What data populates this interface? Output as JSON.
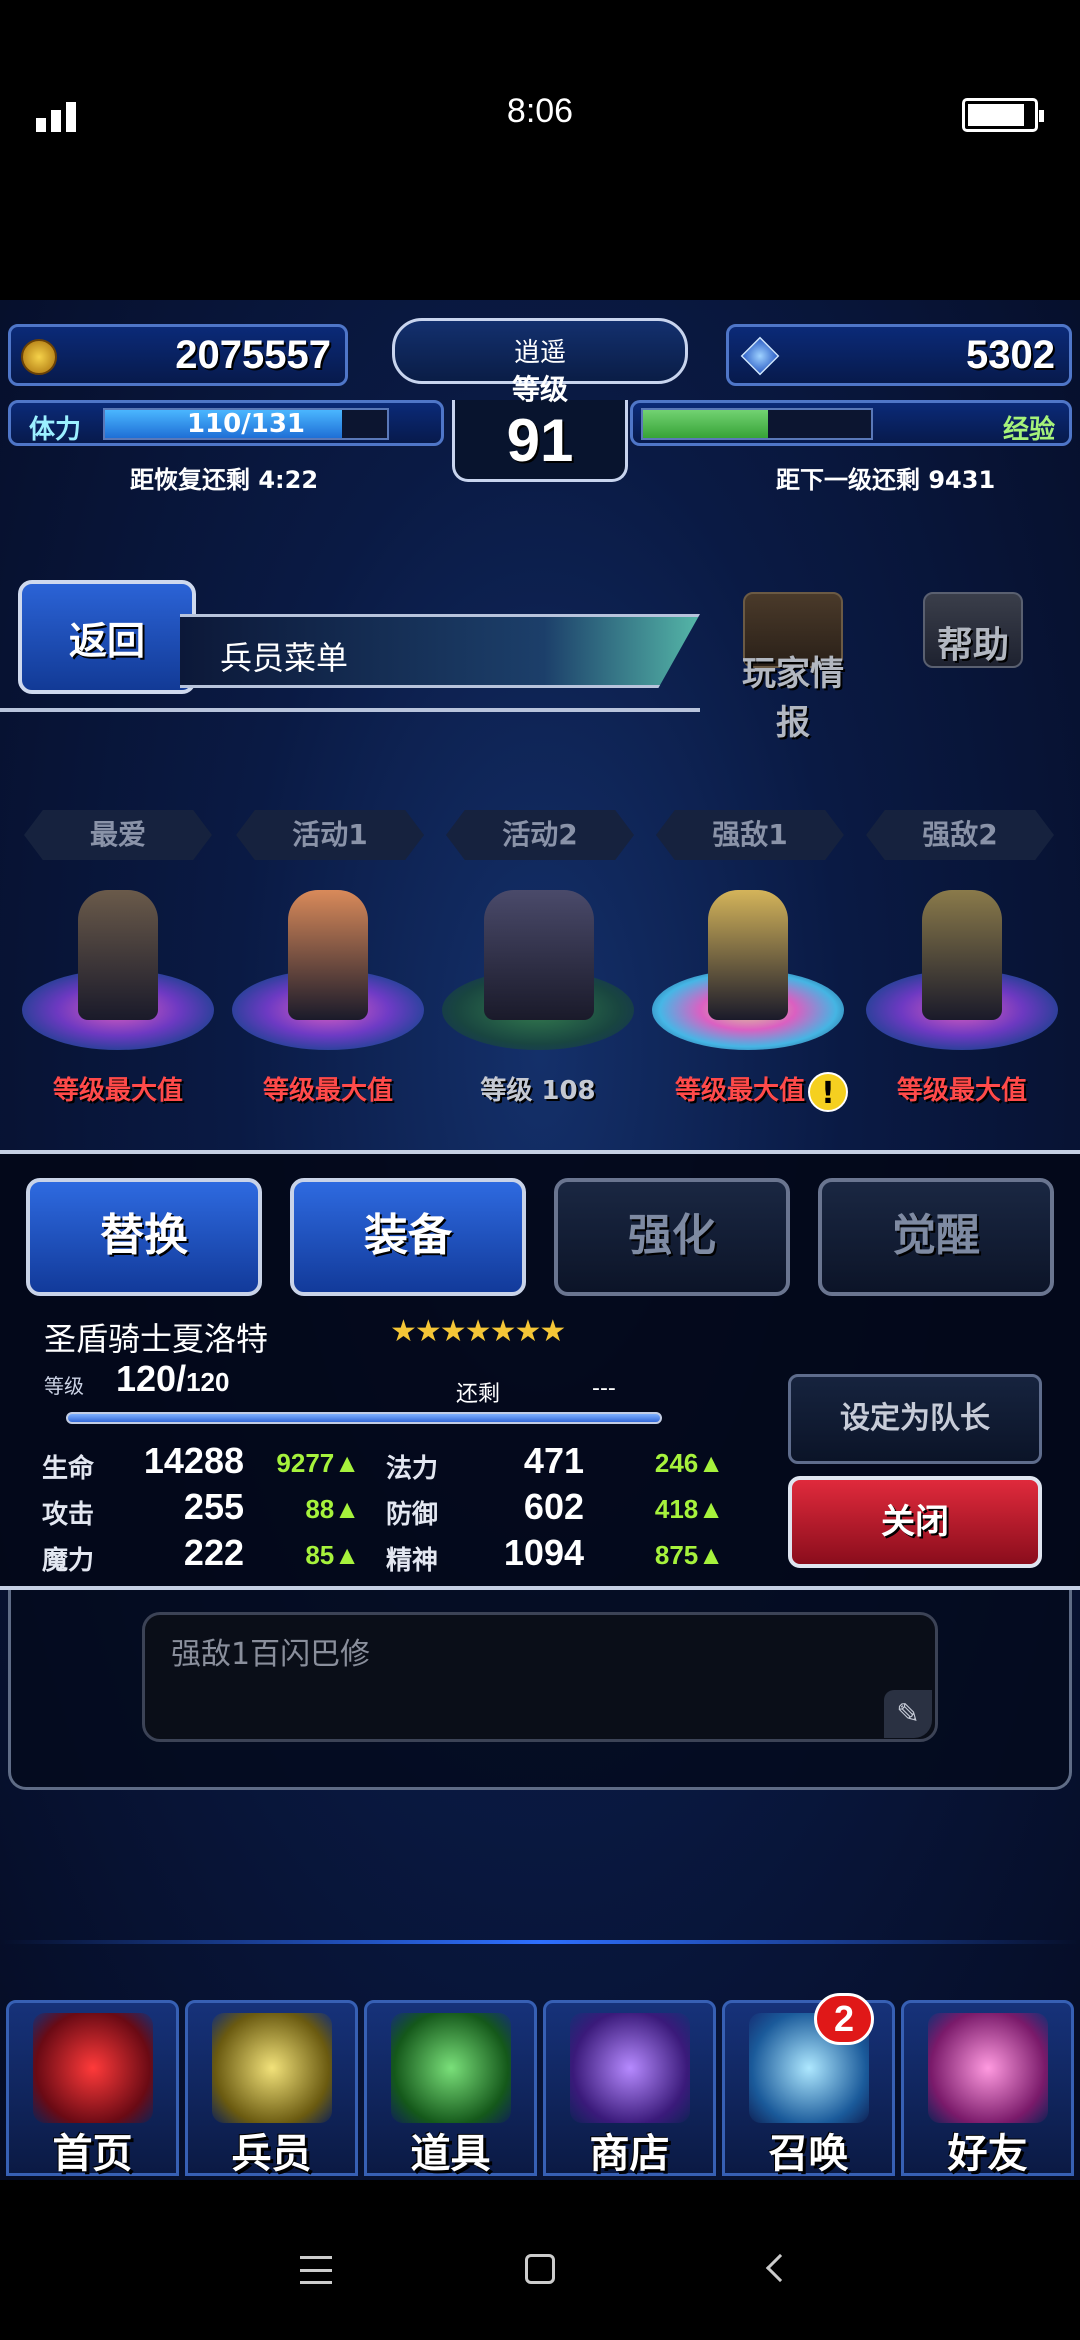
{
  "status": {
    "time": "8:06"
  },
  "hud": {
    "gil": "2075557",
    "gems": "5302",
    "stamina_label": "体力",
    "stamina_value": "110/131",
    "stamina_fraction": 0.84,
    "stamina_recover": "距恢复还剩 4:22",
    "level_title": "逍遥",
    "level_word": "等级",
    "level": "91",
    "exp_label": "经验",
    "exp_fraction": 0.55,
    "exp_next": "距下一级还剩 9431"
  },
  "header": {
    "back_label": "返回",
    "title": "兵员菜单",
    "player_info": "玩家情报",
    "help": "帮助"
  },
  "party": {
    "tabs": [
      "最爱",
      "活动1",
      "活动2",
      "强敌1",
      "强敌2"
    ],
    "units": [
      {
        "caption": "等级最大值",
        "color": "#6a5a4a"
      },
      {
        "caption": "等级最大值",
        "color": "#d98a5a"
      },
      {
        "caption": "等级 108",
        "color": "#4a4a6a"
      },
      {
        "caption": "等级最大值",
        "color": "#d4b45a"
      },
      {
        "caption": "等级最大值",
        "color": "#8a7a4a"
      }
    ]
  },
  "detail": {
    "tabs": {
      "swap": "替换",
      "equip": "装备",
      "enhance": "强化",
      "awaken": "觉醒"
    },
    "unit_name": "圣盾骑士夏洛特",
    "stars": "★★★★★★★",
    "level_label": "等级",
    "level_current": "120/",
    "level_max": "120",
    "remain_label": "还剩",
    "remain_value": "---",
    "stats": [
      {
        "l1": "生命",
        "v1": "14288",
        "b1": "9277",
        "l2": "法力",
        "v2": "471",
        "b2": "246"
      },
      {
        "l1": "攻击",
        "v1": "255",
        "b1": "88",
        "l2": "防御",
        "v2": "602",
        "b2": "418"
      },
      {
        "l1": "魔力",
        "v1": "222",
        "b1": "85",
        "l2": "精神",
        "v2": "1094",
        "b2": "875"
      }
    ],
    "leader_label": "设定为队长",
    "close_label": "关闭"
  },
  "note": {
    "text": "强敌1百闪巴修"
  },
  "nav": {
    "items": [
      "首页",
      "兵员",
      "道具",
      "商店",
      "召唤",
      "好友"
    ],
    "summon_badge": "2"
  }
}
